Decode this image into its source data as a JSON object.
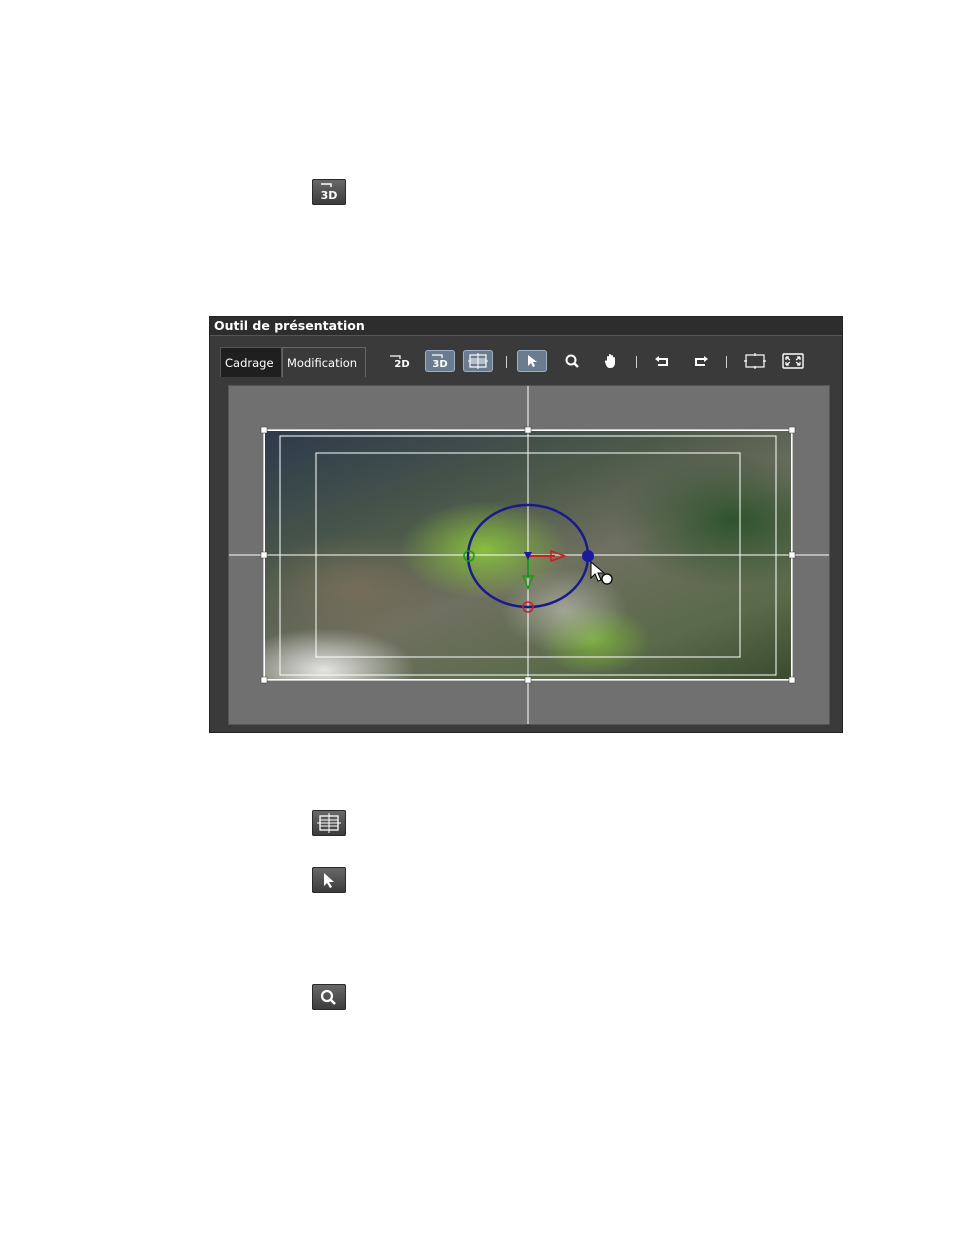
{
  "panel": {
    "title": "Outil de présentation",
    "tabs": [
      {
        "label": "Cadrage",
        "selected": true
      },
      {
        "label": "Modification",
        "selected": false
      }
    ]
  },
  "toolbar": {
    "buttons": [
      {
        "id": "2d",
        "icon": "2d-mode-icon",
        "active": false
      },
      {
        "id": "3d",
        "icon": "3d-mode-icon",
        "active": true
      },
      {
        "id": "grid",
        "icon": "grid-target-icon",
        "active": true
      },
      {
        "id": "select",
        "icon": "arrow-cursor-icon",
        "active": true
      },
      {
        "id": "zoom",
        "icon": "magnifier-icon",
        "active": false
      },
      {
        "id": "pan",
        "icon": "hand-icon",
        "active": false
      },
      {
        "id": "undo",
        "icon": "undo-icon",
        "active": false
      },
      {
        "id": "redo",
        "icon": "redo-icon",
        "active": false
      },
      {
        "id": "fit",
        "icon": "fit-frame-icon",
        "active": false
      },
      {
        "id": "fullscreen",
        "icon": "fullscreen-icon",
        "active": false
      }
    ],
    "labels": {
      "3d": "3D",
      "2d": "2D"
    }
  },
  "standalone_icons": [
    "3d-mode-icon",
    "grid-target-icon",
    "arrow-cursor-icon",
    "magnifier-icon"
  ],
  "colors": {
    "panel_bg": "#3a3a3a",
    "viewport_bg": "#707070",
    "active_button": "#6b7c91",
    "rotation_ring": "#1a1a8c",
    "axis_x": "#cc2020",
    "axis_y": "#1a9a1a"
  }
}
